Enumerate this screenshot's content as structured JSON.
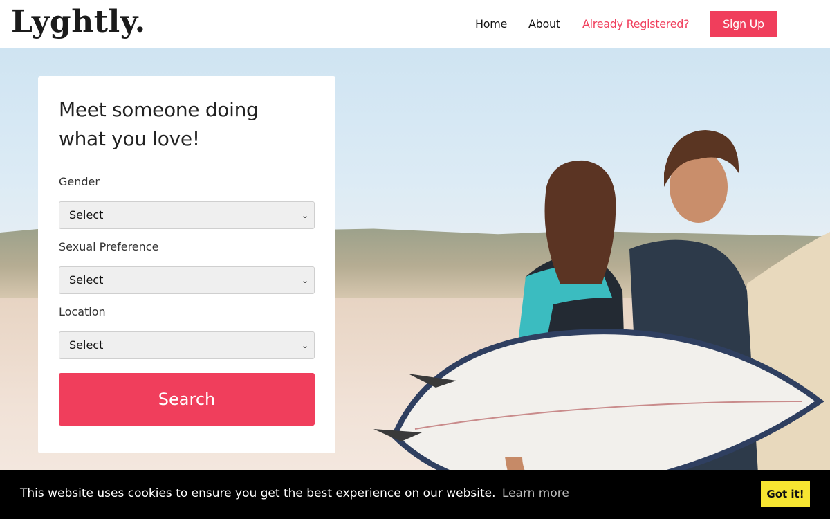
{
  "brand": {
    "logo": "Lyghtly."
  },
  "nav": {
    "home": "Home",
    "about": "About",
    "registered": "Already Registered?",
    "signup": "Sign Up"
  },
  "search_card": {
    "heading": "Meet someone doing what you love!",
    "fields": [
      {
        "label": "Gender",
        "value": "Select"
      },
      {
        "label": "Sexual Preference",
        "value": "Select"
      },
      {
        "label": "Location",
        "value": "Select"
      }
    ],
    "button": "Search"
  },
  "cookie_banner": {
    "message": "This website uses cookies to ensure you get the best experience on our website.",
    "learn_more": "Learn more",
    "accept": "Got it!"
  },
  "colors": {
    "accent": "#f03e5c",
    "cookie_button": "#f7e531"
  }
}
